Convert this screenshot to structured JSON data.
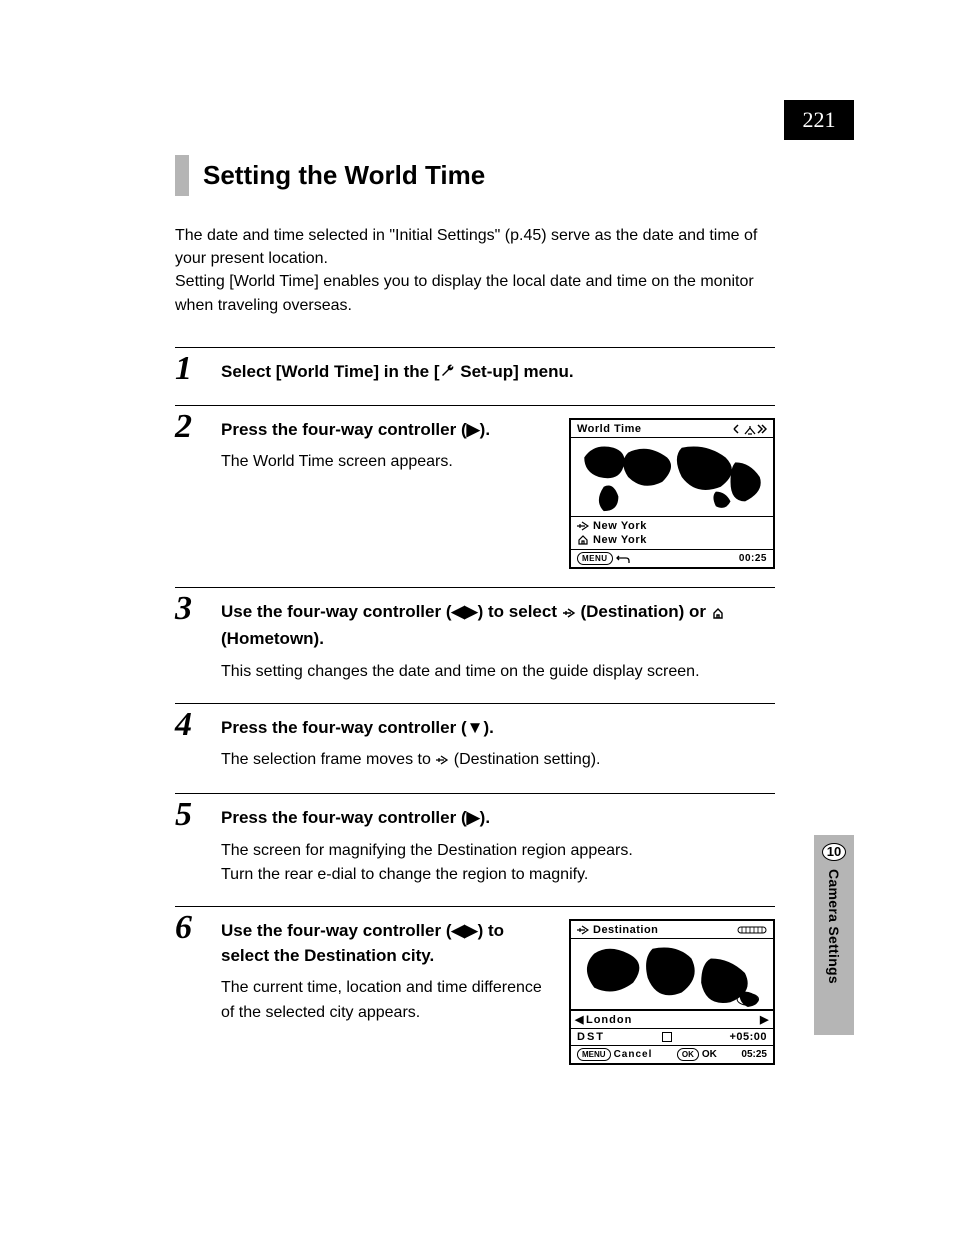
{
  "page_number": "221",
  "section_title": "Setting the World Time",
  "intro": "The date and time selected in \"Initial Settings\" (p.45) serve as the date and time of your present location.\nSetting [World Time] enables you to display the local date and time on the monitor when traveling overseas.",
  "steps": {
    "s1": {
      "num": "1",
      "heading_pre": "Select [World Time] in the [",
      "heading_post": " Set-up] menu."
    },
    "s2": {
      "num": "2",
      "heading": "Press the four-way controller (▶).",
      "body": "The World Time screen appears."
    },
    "s3": {
      "num": "3",
      "heading_a": "Use the four-way controller (◀▶) to select ",
      "heading_b": " (Destination) or ",
      "heading_c": " (Hometown).",
      "body": "This setting changes the date and time on the guide display screen."
    },
    "s4": {
      "num": "4",
      "heading": "Press the four-way controller (▼).",
      "body_a": "The selection frame moves to ",
      "body_b": " (Destination setting)."
    },
    "s5": {
      "num": "5",
      "heading": "Press the four-way controller (▶).",
      "body": "The screen for magnifying the Destination region appears.\nTurn the rear e-dial to change the region to magnify."
    },
    "s6": {
      "num": "6",
      "heading": "Use the four-way controller (◀▶) to select the Destination city.",
      "body": "The current time, location and time difference of the selected city appears."
    }
  },
  "lcd1": {
    "title": "World Time",
    "dest_city": "New York",
    "home_city": "New York",
    "menu_label": "MENU",
    "time": "00:25"
  },
  "lcd2": {
    "title": "Destination",
    "city": "London",
    "dst_label": "DST",
    "offset": "+05:00",
    "menu_label": "MENU",
    "cancel": "Cancel",
    "ok_pill": "OK",
    "ok": "OK",
    "time": "05:25"
  },
  "sidebar": {
    "num": "10",
    "label": "Camera Settings"
  }
}
